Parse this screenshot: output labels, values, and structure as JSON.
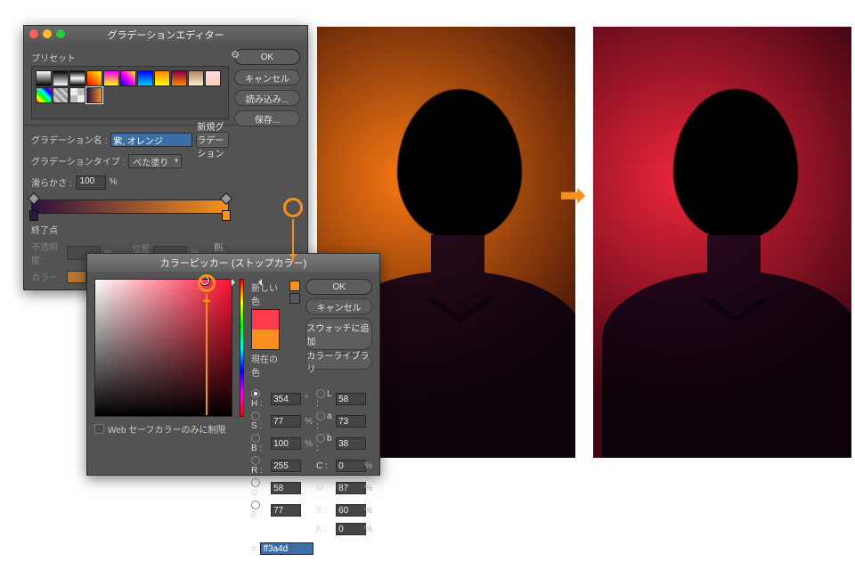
{
  "arrow_glyph": "➡",
  "gradient_editor": {
    "title": "グラデーションエディター",
    "presets_label": "プリセット",
    "buttons": {
      "ok": "OK",
      "cancel": "キャンセル",
      "load": "読み込み...",
      "save": "保存..."
    },
    "name_label": "グラデーション名 :",
    "name_value": "紫, オレンジ",
    "new_gradation": "新規グラデーション",
    "type_label": "グラデーションタイプ :",
    "type_value": "べた塗り",
    "smooth_label": "滑らかさ :",
    "smooth_value": "100",
    "smooth_unit": "%",
    "stops_section": "終了点",
    "opacity_label": "不透明度 :",
    "opacity_unit": "%",
    "position_label": "位置 :",
    "position_unit": "%",
    "delete_label": "削除",
    "color_label": "カラー :",
    "gradient_stops": {
      "left": "#2c1140",
      "right": "#f7901e"
    }
  },
  "color_picker": {
    "title": "カラーピッカー (ストップカラー)",
    "new_label": "新しい色",
    "current_label": "現在の色",
    "buttons": {
      "ok": "OK",
      "cancel": "キャンセル",
      "add_swatch": "スウォッチに追加",
      "library": "カラーライブラリ"
    },
    "websafe_label": "Web セーフカラーのみに制限",
    "hex_label": "#",
    "hex_value": "ff3a4d",
    "new_color": "#ff3a4d",
    "current_color": "#f7901e",
    "fields": {
      "H": "354",
      "S": "77",
      "B": "100",
      "L": "58",
      "a": "73",
      "b_lab": "38",
      "R": "255",
      "G": "58",
      "Bc": "77",
      "C": "0",
      "M": "87",
      "Y": "60",
      "K": "0"
    },
    "units": {
      "deg": "°",
      "pct": "%"
    }
  }
}
